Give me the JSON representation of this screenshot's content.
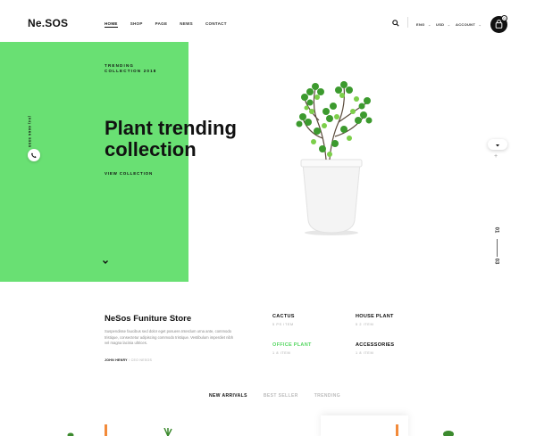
{
  "header": {
    "logo": "Ne.SOS",
    "nav": [
      "HOME",
      "SHOP",
      "PAGE",
      "NEWS",
      "CONTACT"
    ],
    "language": "ENG",
    "currency": "USD",
    "account": "ACCOUNT",
    "cart_count": "0"
  },
  "hero": {
    "eyebrow": "TRENDING COLLECTION 2018",
    "title": "Plant trending collection",
    "cta": "VIEW COLLECTION",
    "phone": "(04) 6666 5555",
    "slide_current": "01",
    "slide_total": "03"
  },
  "store": {
    "title": "NeSos Funiture Store",
    "description": "Suspendisse faucibus sed dolor eget posuere.Interdum urna ante, commodo tristique, consectetur adipiscing commodo tristique. Vestibulum imperdiet nibh vel magna lacinia ultrices.",
    "author_name": "JOHN HENRY",
    "author_role": "CEO NESOS"
  },
  "categories": [
    {
      "name": "CACTUS",
      "count": "5 PS ITEM",
      "highlight": false
    },
    {
      "name": "HOUSE PLANT",
      "count": "5 2 ITEM",
      "highlight": false
    },
    {
      "name": "OFFICE PLANT",
      "count": "1 8 ITEM",
      "highlight": true
    },
    {
      "name": "ACCESSORIES",
      "count": "1 8 ITEM",
      "highlight": false
    }
  ],
  "tabs": [
    "NEW ARRIVALS",
    "BEST SELLER",
    "TRENDING"
  ],
  "colors": {
    "accent": "#69e073",
    "dark": "#111111"
  }
}
